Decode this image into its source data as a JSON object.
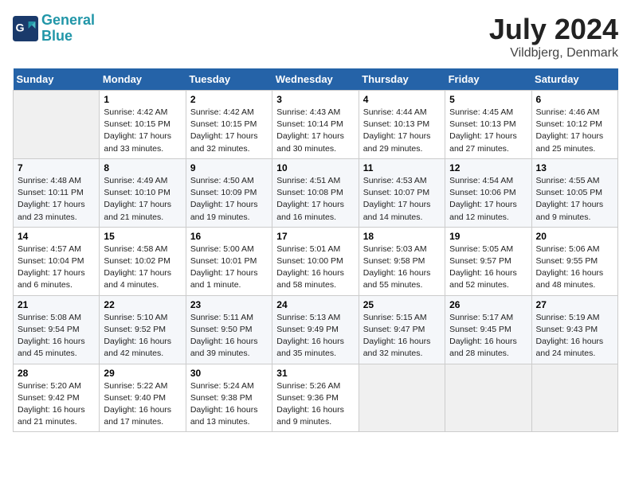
{
  "header": {
    "logo_line1": "General",
    "logo_line2": "Blue",
    "month": "July 2024",
    "location": "Vildbjerg, Denmark"
  },
  "weekdays": [
    "Sunday",
    "Monday",
    "Tuesday",
    "Wednesday",
    "Thursday",
    "Friday",
    "Saturday"
  ],
  "weeks": [
    [
      {
        "day": "",
        "info": ""
      },
      {
        "day": "1",
        "info": "Sunrise: 4:42 AM\nSunset: 10:15 PM\nDaylight: 17 hours\nand 33 minutes."
      },
      {
        "day": "2",
        "info": "Sunrise: 4:42 AM\nSunset: 10:15 PM\nDaylight: 17 hours\nand 32 minutes."
      },
      {
        "day": "3",
        "info": "Sunrise: 4:43 AM\nSunset: 10:14 PM\nDaylight: 17 hours\nand 30 minutes."
      },
      {
        "day": "4",
        "info": "Sunrise: 4:44 AM\nSunset: 10:13 PM\nDaylight: 17 hours\nand 29 minutes."
      },
      {
        "day": "5",
        "info": "Sunrise: 4:45 AM\nSunset: 10:13 PM\nDaylight: 17 hours\nand 27 minutes."
      },
      {
        "day": "6",
        "info": "Sunrise: 4:46 AM\nSunset: 10:12 PM\nDaylight: 17 hours\nand 25 minutes."
      }
    ],
    [
      {
        "day": "7",
        "info": "Sunrise: 4:48 AM\nSunset: 10:11 PM\nDaylight: 17 hours\nand 23 minutes."
      },
      {
        "day": "8",
        "info": "Sunrise: 4:49 AM\nSunset: 10:10 PM\nDaylight: 17 hours\nand 21 minutes."
      },
      {
        "day": "9",
        "info": "Sunrise: 4:50 AM\nSunset: 10:09 PM\nDaylight: 17 hours\nand 19 minutes."
      },
      {
        "day": "10",
        "info": "Sunrise: 4:51 AM\nSunset: 10:08 PM\nDaylight: 17 hours\nand 16 minutes."
      },
      {
        "day": "11",
        "info": "Sunrise: 4:53 AM\nSunset: 10:07 PM\nDaylight: 17 hours\nand 14 minutes."
      },
      {
        "day": "12",
        "info": "Sunrise: 4:54 AM\nSunset: 10:06 PM\nDaylight: 17 hours\nand 12 minutes."
      },
      {
        "day": "13",
        "info": "Sunrise: 4:55 AM\nSunset: 10:05 PM\nDaylight: 17 hours\nand 9 minutes."
      }
    ],
    [
      {
        "day": "14",
        "info": "Sunrise: 4:57 AM\nSunset: 10:04 PM\nDaylight: 17 hours\nand 6 minutes."
      },
      {
        "day": "15",
        "info": "Sunrise: 4:58 AM\nSunset: 10:02 PM\nDaylight: 17 hours\nand 4 minutes."
      },
      {
        "day": "16",
        "info": "Sunrise: 5:00 AM\nSunset: 10:01 PM\nDaylight: 17 hours\nand 1 minute."
      },
      {
        "day": "17",
        "info": "Sunrise: 5:01 AM\nSunset: 10:00 PM\nDaylight: 16 hours\nand 58 minutes."
      },
      {
        "day": "18",
        "info": "Sunrise: 5:03 AM\nSunset: 9:58 PM\nDaylight: 16 hours\nand 55 minutes."
      },
      {
        "day": "19",
        "info": "Sunrise: 5:05 AM\nSunset: 9:57 PM\nDaylight: 16 hours\nand 52 minutes."
      },
      {
        "day": "20",
        "info": "Sunrise: 5:06 AM\nSunset: 9:55 PM\nDaylight: 16 hours\nand 48 minutes."
      }
    ],
    [
      {
        "day": "21",
        "info": "Sunrise: 5:08 AM\nSunset: 9:54 PM\nDaylight: 16 hours\nand 45 minutes."
      },
      {
        "day": "22",
        "info": "Sunrise: 5:10 AM\nSunset: 9:52 PM\nDaylight: 16 hours\nand 42 minutes."
      },
      {
        "day": "23",
        "info": "Sunrise: 5:11 AM\nSunset: 9:50 PM\nDaylight: 16 hours\nand 39 minutes."
      },
      {
        "day": "24",
        "info": "Sunrise: 5:13 AM\nSunset: 9:49 PM\nDaylight: 16 hours\nand 35 minutes."
      },
      {
        "day": "25",
        "info": "Sunrise: 5:15 AM\nSunset: 9:47 PM\nDaylight: 16 hours\nand 32 minutes."
      },
      {
        "day": "26",
        "info": "Sunrise: 5:17 AM\nSunset: 9:45 PM\nDaylight: 16 hours\nand 28 minutes."
      },
      {
        "day": "27",
        "info": "Sunrise: 5:19 AM\nSunset: 9:43 PM\nDaylight: 16 hours\nand 24 minutes."
      }
    ],
    [
      {
        "day": "28",
        "info": "Sunrise: 5:20 AM\nSunset: 9:42 PM\nDaylight: 16 hours\nand 21 minutes."
      },
      {
        "day": "29",
        "info": "Sunrise: 5:22 AM\nSunset: 9:40 PM\nDaylight: 16 hours\nand 17 minutes."
      },
      {
        "day": "30",
        "info": "Sunrise: 5:24 AM\nSunset: 9:38 PM\nDaylight: 16 hours\nand 13 minutes."
      },
      {
        "day": "31",
        "info": "Sunrise: 5:26 AM\nSunset: 9:36 PM\nDaylight: 16 hours\nand 9 minutes."
      },
      {
        "day": "",
        "info": ""
      },
      {
        "day": "",
        "info": ""
      },
      {
        "day": "",
        "info": ""
      }
    ]
  ]
}
